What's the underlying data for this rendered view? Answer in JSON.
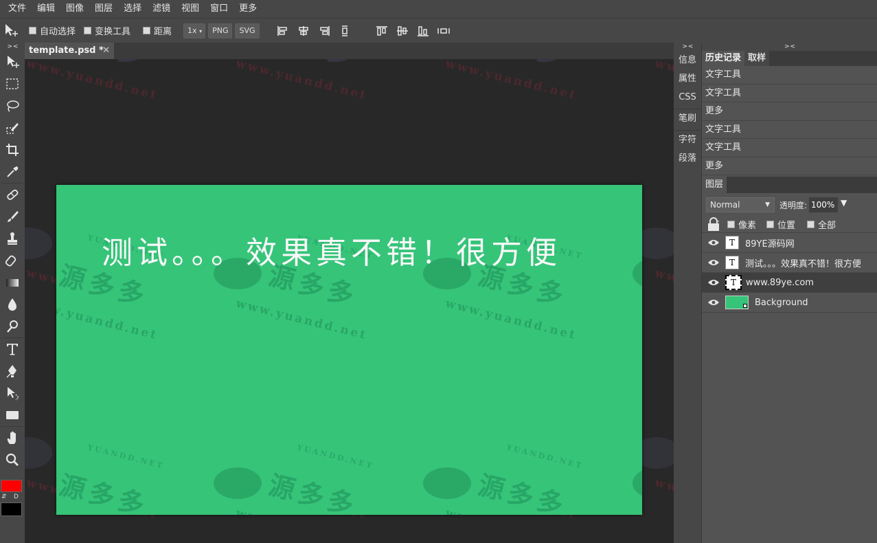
{
  "menu": [
    "文件",
    "编辑",
    "图像",
    "图层",
    "选择",
    "滤镜",
    "视图",
    "窗口",
    "更多"
  ],
  "options": {
    "auto_select": "自动选择",
    "transform": "变换工具",
    "distance": "距离",
    "zoom": "1x",
    "png": "PNG",
    "svg": "SVG"
  },
  "doc_tab": {
    "title": "template.psd *",
    "close": "✕"
  },
  "collapse_glyph": "> <",
  "toolbar": {
    "swap": "⇵",
    "default": "D",
    "foreground_color": "#ff0000",
    "background_color": "#000000"
  },
  "canvas": {
    "text": "测试。。。效果真不错！很方便",
    "background_color": "#36c479"
  },
  "watermark": {
    "big": "源多多",
    "url": "www.yuandd.net",
    "caps": "YUANDD.NET"
  },
  "icon_column": [
    "信息",
    "属性",
    "CSS",
    "笔刷",
    "字符",
    "段落"
  ],
  "panel": {
    "tabs": [
      "历史记录",
      "取样"
    ],
    "history": [
      "文字工具",
      "文字工具",
      "更多",
      "文字工具",
      "文字工具",
      "更多"
    ],
    "layers_tab": "图层",
    "blend_mode": "Normal",
    "opacity_label": "透明度:",
    "opacity_value": "100%",
    "lock_colon": ":",
    "locks": [
      "像素",
      "位置",
      "全部"
    ],
    "layers": [
      "89YE源码网",
      "测试。。。效果真不错！很方便",
      "www.89ye.com",
      "Background"
    ]
  }
}
